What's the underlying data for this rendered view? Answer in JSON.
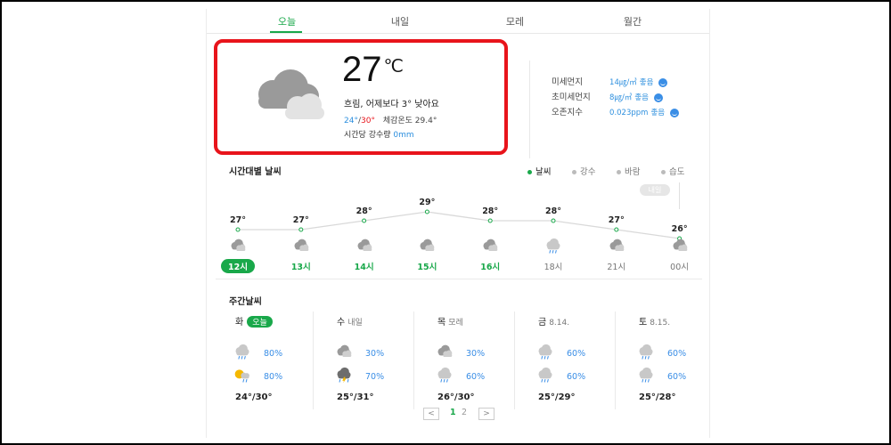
{
  "tabs": [
    {
      "label": "오늘",
      "active": true
    },
    {
      "label": "내일",
      "active": false
    },
    {
      "label": "모레",
      "active": false
    },
    {
      "label": "월간",
      "active": false
    }
  ],
  "current": {
    "temp": "27",
    "unit": "℃",
    "summary": "흐림, 어제보다 3° 낮아요",
    "low": "24°",
    "slash": "/",
    "high": "30°",
    "feels": "체감온도 29.4°",
    "rain_label": "시간당 강수량",
    "rain_value": "0mm",
    "icon": "cloudy-icon"
  },
  "air": [
    {
      "label": "미세먼지",
      "value": "14㎍/㎥",
      "grade": "좋음"
    },
    {
      "label": "초미세먼지",
      "value": "8㎍/㎥",
      "grade": "좋음"
    },
    {
      "label": "오존지수",
      "value": "0.023ppm",
      "grade": "좋음"
    }
  ],
  "hourly": {
    "title": "시간대별 날씨",
    "legend": [
      {
        "label": "날씨",
        "active": true
      },
      {
        "label": "강수",
        "active": false
      },
      {
        "label": "바람",
        "active": false
      },
      {
        "label": "습도",
        "active": false
      }
    ],
    "tomorrow_label": "내일",
    "items": [
      {
        "time": "12시",
        "temp": "27°",
        "value": 27,
        "icon": "cloudy-icon",
        "style": "pill"
      },
      {
        "time": "13시",
        "temp": "27°",
        "value": 27,
        "icon": "cloudy-icon",
        "style": "green"
      },
      {
        "time": "14시",
        "temp": "28°",
        "value": 28,
        "icon": "cloudy-icon",
        "style": "green"
      },
      {
        "time": "15시",
        "temp": "29°",
        "value": 29,
        "icon": "cloudy-icon",
        "style": "green"
      },
      {
        "time": "16시",
        "temp": "28°",
        "value": 28,
        "icon": "cloudy-icon",
        "style": "green"
      },
      {
        "time": "18시",
        "temp": "28°",
        "value": 28,
        "icon": "rain-icon",
        "style": "gray"
      },
      {
        "time": "21시",
        "temp": "27°",
        "value": 27,
        "icon": "cloudy-icon",
        "style": "gray"
      },
      {
        "time": "00시",
        "temp": "26°",
        "value": 26,
        "icon": "cloudy-icon",
        "style": "gray"
      }
    ]
  },
  "weekly": {
    "title": "주간날씨",
    "days": [
      {
        "day": "화",
        "sub": "",
        "badge": "오늘",
        "am_icon": "rain-icon",
        "am_pct": "80%",
        "pm_icon": "sun-rain-icon",
        "pm_pct": "80%",
        "temps": "24°/30°"
      },
      {
        "day": "수",
        "sub": "내일",
        "badge": "",
        "am_icon": "cloudy-icon",
        "am_pct": "30%",
        "pm_icon": "thunder-rain-icon",
        "pm_pct": "70%",
        "temps": "25°/31°"
      },
      {
        "day": "목",
        "sub": "모레",
        "badge": "",
        "am_icon": "cloudy-icon",
        "am_pct": "30%",
        "pm_icon": "rain-icon",
        "pm_pct": "60%",
        "temps": "26°/30°"
      },
      {
        "day": "금",
        "sub": "8.14.",
        "badge": "",
        "am_icon": "rain-icon",
        "am_pct": "60%",
        "pm_icon": "rain-icon",
        "pm_pct": "60%",
        "temps": "25°/29°"
      },
      {
        "day": "토",
        "sub": "8.15.",
        "badge": "",
        "am_icon": "rain-icon",
        "am_pct": "60%",
        "pm_icon": "rain-icon",
        "pm_pct": "60%",
        "temps": "25°/28°"
      }
    ]
  },
  "pager": {
    "prev": "<",
    "pages": [
      "1",
      "2"
    ],
    "current": "1",
    "next": ">"
  },
  "colors": {
    "green": "#19a84a",
    "red_highlight": "#e8141b",
    "blue": "#2d8fde"
  }
}
